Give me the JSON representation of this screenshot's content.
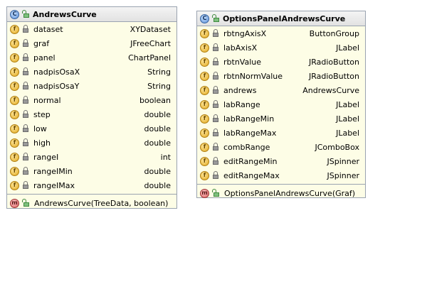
{
  "classes": [
    {
      "title": "AndrewsCurve",
      "header_badge": "C",
      "fields": [
        {
          "name": "dataset",
          "type": "XYDataset"
        },
        {
          "name": "graf",
          "type": "JFreeChart"
        },
        {
          "name": "panel",
          "type": "ChartPanel"
        },
        {
          "name": "nadpisOsaX",
          "type": "String"
        },
        {
          "name": "nadpisOsaY",
          "type": "String"
        },
        {
          "name": "normal",
          "type": "boolean"
        },
        {
          "name": "step",
          "type": "double"
        },
        {
          "name": "low",
          "type": "double"
        },
        {
          "name": "high",
          "type": "double"
        },
        {
          "name": "rangeI",
          "type": "int"
        },
        {
          "name": "rangeIMin",
          "type": "double"
        },
        {
          "name": "rangeIMax",
          "type": "double"
        }
      ],
      "methods": [
        {
          "signature": "AndrewsCurve(TreeData, boolean)"
        }
      ]
    },
    {
      "title": "OptionsPanelAndrewsCurve",
      "header_badge": "C",
      "fields": [
        {
          "name": "rbtngAxisX",
          "type": "ButtonGroup"
        },
        {
          "name": "labAxisX",
          "type": "JLabel"
        },
        {
          "name": "rbtnValue",
          "type": "JRadioButton"
        },
        {
          "name": "rbtnNormValue",
          "type": "JRadioButton"
        },
        {
          "name": "andrews",
          "type": "AndrewsCurve"
        },
        {
          "name": "labRange",
          "type": "JLabel"
        },
        {
          "name": "labRangeMin",
          "type": "JLabel"
        },
        {
          "name": "labRangeMax",
          "type": "JLabel"
        },
        {
          "name": "combRange",
          "type": "JComboBox"
        },
        {
          "name": "editRangeMin",
          "type": "JSpinner"
        },
        {
          "name": "editRangeMax",
          "type": "JSpinner"
        }
      ],
      "methods": [
        {
          "signature": "OptionsPanelAndrewsCurve(Graf)"
        }
      ]
    }
  ],
  "badges": {
    "field": "f",
    "method": "m"
  },
  "colors": {
    "box_fill": "#fdfde6",
    "border": "#9aa3b0",
    "header": "#e8e8e8"
  },
  "icons": {
    "class": "class-icon",
    "field": "field-icon",
    "method": "method-icon",
    "private": "lock-icon",
    "public": "public-access-icon"
  }
}
